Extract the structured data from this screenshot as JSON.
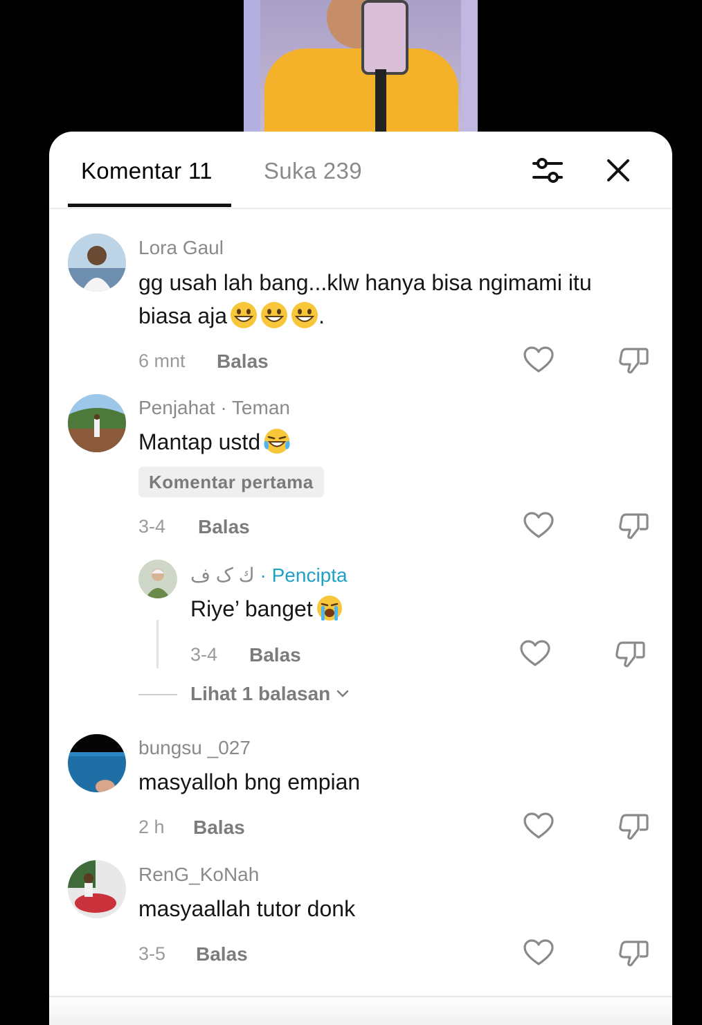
{
  "tabs": {
    "comments": "Komentar 11",
    "likes": "Suka 239"
  },
  "icons": {
    "filter": "sliders-icon",
    "close": "close-icon",
    "like": "heart-icon",
    "dislike": "thumbs-down-icon"
  },
  "comments": [
    {
      "username": "Lora Gaul",
      "text_line1": "gg usah lah bang...klw hanya bisa ngimami itu",
      "text_line2": "biasa aja",
      "text_suffix": ".",
      "emoji": "grinning-face-emoji",
      "time": "6 mnt",
      "reply": "Balas"
    },
    {
      "username": "Penjahat",
      "relation": " · Teman",
      "text": "Mantap ustd",
      "emoji": "tears-of-joy-emoji",
      "badge": "Komentar pertama",
      "time": "3-4",
      "reply": "Balas",
      "replies": [
        {
          "username": "ﻙ ﮎ ﻑ",
          "role": " · Pencipta",
          "text": "Riye’ banget",
          "emoji": "loudly-crying-emoji",
          "time": "3-4",
          "reply": "Balas"
        }
      ],
      "view_replies": "Lihat 1 balasan"
    },
    {
      "username": "bungsu _027",
      "text": "masyalloh bng empian",
      "time": "2 h",
      "reply": "Balas"
    },
    {
      "username": "RenG_KoNah",
      "text": "masyaallah tutor donk",
      "time": "3-5",
      "reply": "Balas"
    }
  ],
  "colors": {
    "creator": "#1da1c7",
    "muted": "#8a8a8a",
    "background": "#000000"
  }
}
